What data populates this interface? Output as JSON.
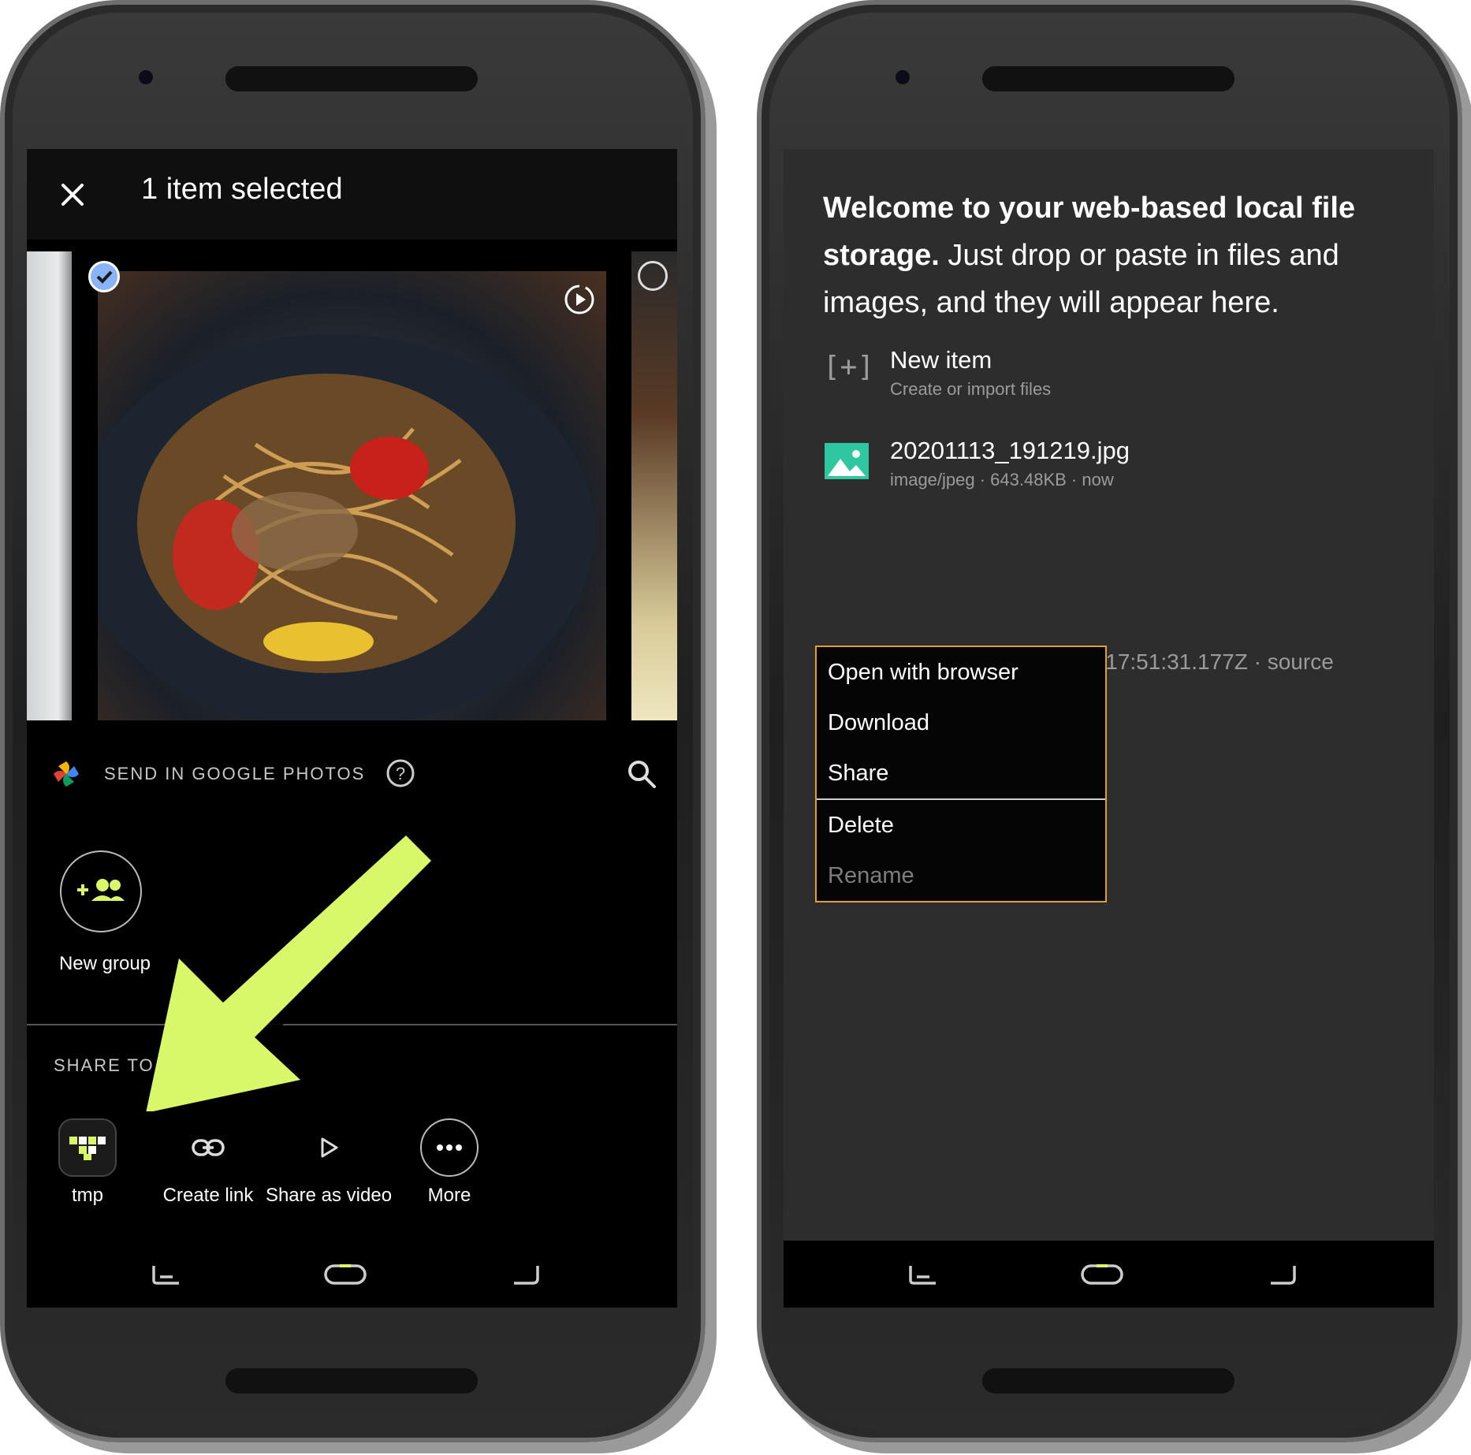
{
  "left_screen": {
    "appbar": {
      "title": "1 item selected"
    },
    "send_section": {
      "label": "SEND IN GOOGLE PHOTOS"
    },
    "contacts": [
      {
        "label": "New group"
      }
    ],
    "share_section": {
      "label": "SHARE TO A"
    },
    "share_actions": [
      {
        "label": "tmp",
        "icon": "tmp-app-icon"
      },
      {
        "label": "Create link",
        "icon": "link-icon"
      },
      {
        "label": "Share as video",
        "icon": "play-icon"
      },
      {
        "label": "More",
        "icon": "more-icon"
      }
    ],
    "annotation": {
      "color": "#d8f86a"
    }
  },
  "right_screen": {
    "welcome_bold": "Welcome to your web-based local file storage.",
    "welcome_rest": " Just drop or paste in files and images, and they will appear here.",
    "new_item": {
      "icon_text": "[+]",
      "title": "New item",
      "subtitle": "Create or import files"
    },
    "file": {
      "title": "20201113_191219.jpg",
      "subtitle": "image/jpeg · 643.48KB · now"
    },
    "background_text": "17T17:51:31.177Z · source",
    "context_menu": {
      "items": [
        {
          "label": "Open with browser",
          "enabled": true
        },
        {
          "label": "Download",
          "enabled": true
        },
        {
          "label": "Share",
          "enabled": true
        },
        {
          "label": "Delete",
          "enabled": true
        },
        {
          "label": "Rename",
          "enabled": false
        }
      ],
      "border_color": "#e0a030"
    }
  }
}
